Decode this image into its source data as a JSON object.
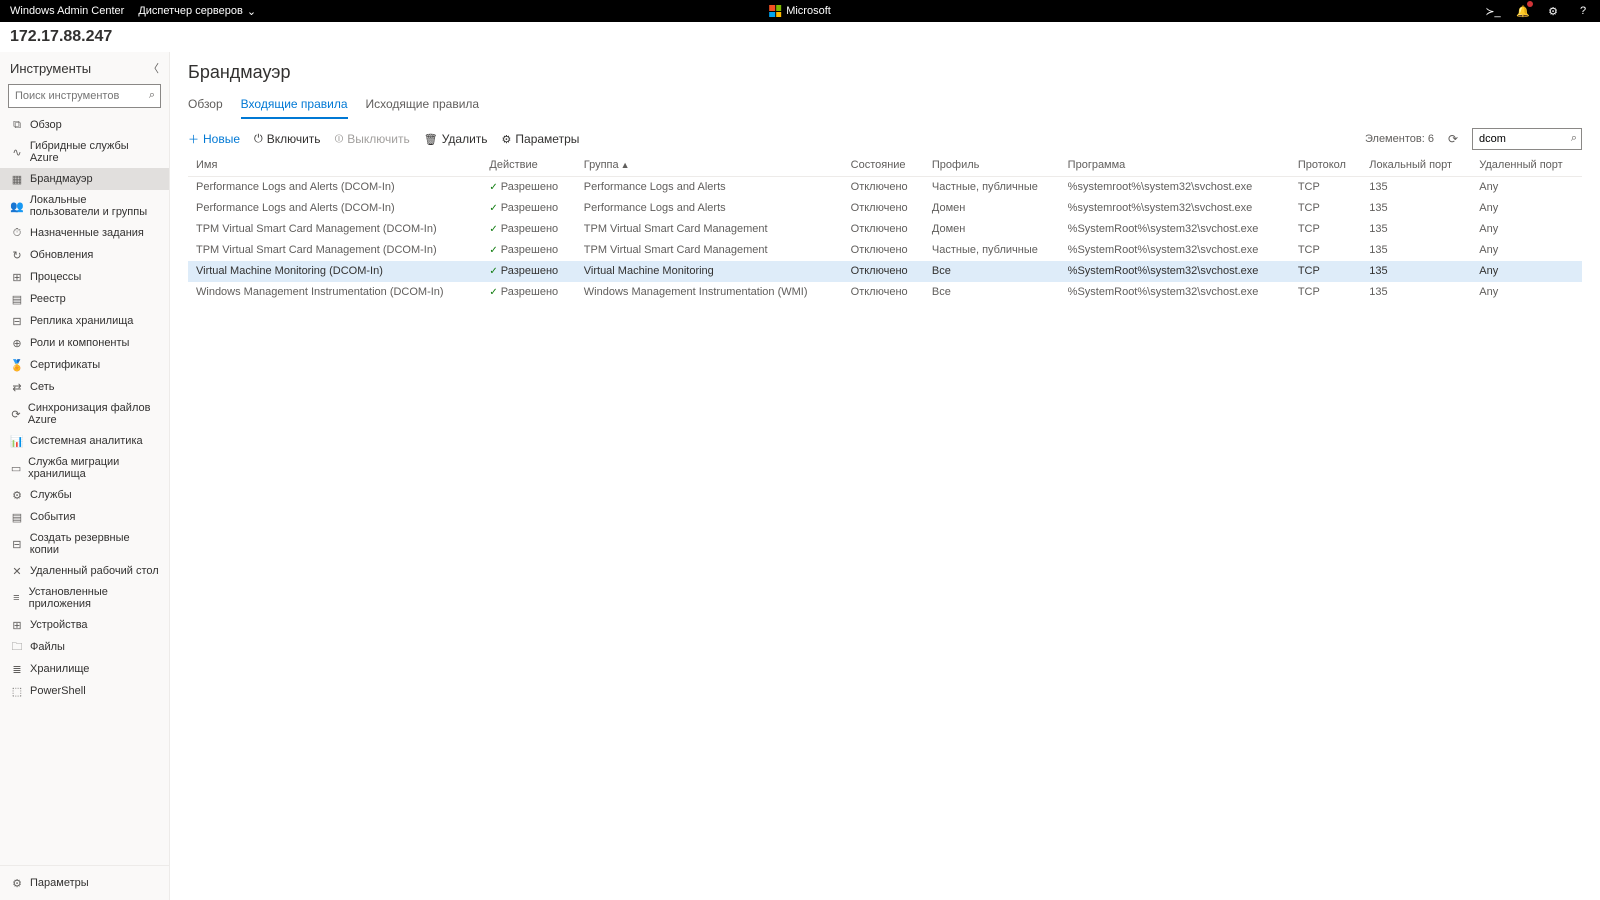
{
  "topbar": {
    "brand": "Windows Admin Center",
    "dropdown": "Диспетчер серверов",
    "microsoft": "Microsoft"
  },
  "host": "172.17.88.247",
  "sidebar": {
    "title": "Инструменты",
    "search_placeholder": "Поиск инструментов",
    "items": [
      {
        "icon": "⧉",
        "label": "Обзор"
      },
      {
        "icon": "∿",
        "label": "Гибридные службы Azure"
      },
      {
        "icon": "▦",
        "label": "Брандмауэр",
        "active": true
      },
      {
        "icon": "👥",
        "label": "Локальные пользователи и группы"
      },
      {
        "icon": "⏱",
        "label": "Назначенные задания"
      },
      {
        "icon": "↻",
        "label": "Обновления"
      },
      {
        "icon": "⊞",
        "label": "Процессы"
      },
      {
        "icon": "▤",
        "label": "Реестр"
      },
      {
        "icon": "⊟",
        "label": "Реплика хранилища"
      },
      {
        "icon": "⊕",
        "label": "Роли и компоненты"
      },
      {
        "icon": "🏅",
        "label": "Сертификаты"
      },
      {
        "icon": "⇄",
        "label": "Сеть"
      },
      {
        "icon": "⟳",
        "label": "Синхронизация файлов Azure"
      },
      {
        "icon": "📊",
        "label": "Системная аналитика"
      },
      {
        "icon": "▭",
        "label": "Служба миграции хранилища"
      },
      {
        "icon": "⚙",
        "label": "Службы"
      },
      {
        "icon": "▤",
        "label": "События"
      },
      {
        "icon": "⊟",
        "label": "Создать резервные копии"
      },
      {
        "icon": "✕",
        "label": "Удаленный рабочий стол"
      },
      {
        "icon": "≡",
        "label": "Установленные приложения"
      },
      {
        "icon": "⊞",
        "label": "Устройства"
      },
      {
        "icon": "🗀",
        "label": "Файлы"
      },
      {
        "icon": "≣",
        "label": "Хранилище"
      },
      {
        "icon": "⬚",
        "label": "PowerShell"
      }
    ],
    "footer": {
      "icon": "⚙",
      "label": "Параметры"
    }
  },
  "main": {
    "title": "Брандмауэр",
    "tabs": [
      {
        "label": "Обзор"
      },
      {
        "label": "Входящие правила",
        "active": true
      },
      {
        "label": "Исходящие правила"
      }
    ],
    "toolbar": {
      "new": "Новые",
      "enable": "Включить",
      "disable": "Выключить",
      "delete": "Удалить",
      "settings": "Параметры",
      "count_label": "Элементов:",
      "count_value": "6",
      "search_value": "dcom"
    },
    "columns": [
      "Имя",
      "Действие",
      "Группа",
      "Состояние",
      "Профиль",
      "Программа",
      "Протокол",
      "Локальный порт",
      "Удаленный порт"
    ],
    "sort_col": 2,
    "rows": [
      {
        "cells": [
          "Performance Logs and Alerts (DCOM-In)",
          "Разрешено",
          "Performance Logs and Alerts",
          "Отключено",
          "Частные, публичные",
          "%systemroot%\\system32\\svchost.exe",
          "TCP",
          "135",
          "Any"
        ]
      },
      {
        "cells": [
          "Performance Logs and Alerts (DCOM-In)",
          "Разрешено",
          "Performance Logs and Alerts",
          "Отключено",
          "Домен",
          "%systemroot%\\system32\\svchost.exe",
          "TCP",
          "135",
          "Any"
        ]
      },
      {
        "cells": [
          "TPM Virtual Smart Card Management (DCOM-In)",
          "Разрешено",
          "TPM Virtual Smart Card Management",
          "Отключено",
          "Домен",
          "%SystemRoot%\\system32\\svchost.exe",
          "TCP",
          "135",
          "Any"
        ]
      },
      {
        "cells": [
          "TPM Virtual Smart Card Management (DCOM-In)",
          "Разрешено",
          "TPM Virtual Smart Card Management",
          "Отключено",
          "Частные, публичные",
          "%SystemRoot%\\system32\\svchost.exe",
          "TCP",
          "135",
          "Any"
        ]
      },
      {
        "cells": [
          "Virtual Machine Monitoring (DCOM-In)",
          "Разрешено",
          "Virtual Machine Monitoring",
          "Отключено",
          "Все",
          "%SystemRoot%\\system32\\svchost.exe",
          "TCP",
          "135",
          "Any"
        ],
        "selected": true
      },
      {
        "cells": [
          "Windows Management Instrumentation (DCOM-In)",
          "Разрешено",
          "Windows Management Instrumentation (WMI)",
          "Отключено",
          "Все",
          "%SystemRoot%\\system32\\svchost.exe",
          "TCP",
          "135",
          "Any"
        ]
      }
    ]
  }
}
